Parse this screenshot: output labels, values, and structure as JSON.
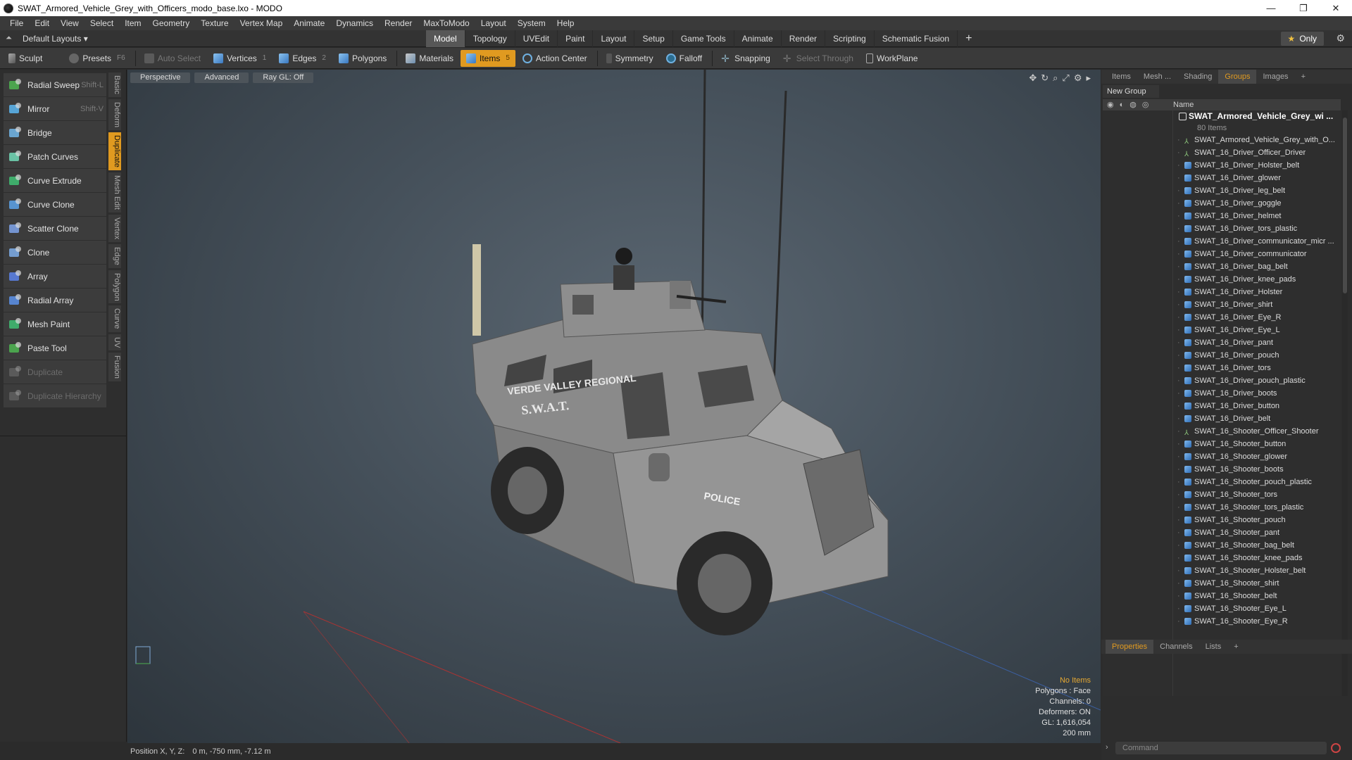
{
  "window": {
    "title": "SWAT_Armored_Vehicle_Grey_with_Officers_modo_base.lxo - MODO",
    "controls": [
      "—",
      "❐",
      "✕"
    ]
  },
  "menu": [
    "File",
    "Edit",
    "View",
    "Select",
    "Item",
    "Geometry",
    "Texture",
    "Vertex Map",
    "Animate",
    "Dynamics",
    "Render",
    "MaxToModo",
    "Layout",
    "System",
    "Help"
  ],
  "layout": {
    "selector": "Default Layouts ▾",
    "tabs": [
      "Model",
      "Topology",
      "UVEdit",
      "Paint",
      "Layout",
      "Setup",
      "Game Tools",
      "Animate",
      "Render",
      "Scripting",
      "Schematic Fusion"
    ],
    "active_tab": "Model",
    "plus": "+",
    "only_star": "★",
    "only_label": "Only",
    "gear": "⚙"
  },
  "toolbar": {
    "sculpt": "Sculpt",
    "presets": "Presets",
    "presets_key": "F6",
    "auto_select": "Auto Select",
    "vertices": "Vertices",
    "vertices_num": "1",
    "edges": "Edges",
    "edges_num": "2",
    "polygons": "Polygons",
    "materials": "Materials",
    "items": "Items",
    "items_num": "5",
    "action_center": "Action Center",
    "symmetry": "Symmetry",
    "falloff": "Falloff",
    "snapping": "Snapping",
    "select_through": "Select Through",
    "workplane": "WorkPlane"
  },
  "tools": [
    {
      "label": "Radial Sweep",
      "shortcut": "Shift-L",
      "disabled": false
    },
    {
      "label": "Mirror",
      "shortcut": "Shift-V",
      "disabled": false
    },
    {
      "label": "Bridge",
      "shortcut": "",
      "disabled": false
    },
    {
      "label": "Patch Curves",
      "shortcut": "",
      "disabled": false
    },
    {
      "label": "Curve Extrude",
      "shortcut": "",
      "disabled": false
    },
    {
      "label": "Curve Clone",
      "shortcut": "",
      "disabled": false
    },
    {
      "label": "Scatter Clone",
      "shortcut": "",
      "disabled": false
    },
    {
      "label": "Clone",
      "shortcut": "",
      "disabled": false
    },
    {
      "label": "Array",
      "shortcut": "",
      "disabled": false
    },
    {
      "label": "Radial Array",
      "shortcut": "",
      "disabled": false
    },
    {
      "label": "Mesh Paint",
      "shortcut": "",
      "disabled": false
    },
    {
      "label": "Paste Tool",
      "shortcut": "",
      "disabled": false
    },
    {
      "label": "Duplicate",
      "shortcut": "",
      "disabled": true
    },
    {
      "label": "Duplicate Hierarchy",
      "shortcut": "",
      "disabled": true
    }
  ],
  "side_tabs": [
    "Basic",
    "Deform",
    "Duplicate",
    "Mesh Edit",
    "Vertex",
    "Edge",
    "Polygon",
    "Curve",
    "UV",
    "Fusion"
  ],
  "active_side_tab": "Duplicate",
  "viewport": {
    "view": "Perspective",
    "shading": "Advanced",
    "raygl": "Ray GL: Off",
    "icons": [
      "✥",
      "↻",
      "⌕",
      "⤢",
      "⚙",
      "▸"
    ],
    "info": {
      "items": "No Items",
      "polygons": "Polygons : Face",
      "channels": "Channels: 0",
      "deformers": "Deformers: ON",
      "gl": "GL: 1,616,054",
      "scale": "200 mm"
    },
    "decals": {
      "line1": "VERDE VALLEY REGIONAL",
      "line2": "S.W.A.T.",
      "police": "POLICE"
    }
  },
  "status": {
    "label": "Position X, Y, Z:",
    "value": "0 m, -750 mm, -7.12 m"
  },
  "right_panel": {
    "tabs": [
      "Items",
      "Mesh ...",
      "Shading",
      "Groups",
      "Images",
      "+"
    ],
    "active_tab": "Groups",
    "new_group": "New Group",
    "name_header": "Name",
    "group_name": "SWAT_Armored_Vehicle_Grey_wi ...",
    "group_count": "80 Items",
    "items": [
      {
        "name": "SWAT_Armored_Vehicle_Grey_with_O...",
        "type": "locator"
      },
      {
        "name": "SWAT_16_Driver_Officer_Driver",
        "type": "locator"
      },
      {
        "name": "SWAT_16_Driver_Holster_belt",
        "type": "mesh"
      },
      {
        "name": "SWAT_16_Driver_glower",
        "type": "mesh"
      },
      {
        "name": "SWAT_16_Driver_leg_belt",
        "type": "mesh"
      },
      {
        "name": "SWAT_16_Driver_goggle",
        "type": "mesh"
      },
      {
        "name": "SWAT_16_Driver_helmet",
        "type": "mesh"
      },
      {
        "name": "SWAT_16_Driver_tors_plastic",
        "type": "mesh"
      },
      {
        "name": "SWAT_16_Driver_communicator_micr ...",
        "type": "mesh"
      },
      {
        "name": "SWAT_16_Driver_communicator",
        "type": "mesh"
      },
      {
        "name": "SWAT_16_Driver_bag_belt",
        "type": "mesh"
      },
      {
        "name": "SWAT_16_Driver_knee_pads",
        "type": "mesh"
      },
      {
        "name": "SWAT_16_Driver_Holster",
        "type": "mesh"
      },
      {
        "name": "SWAT_16_Driver_shirt",
        "type": "mesh"
      },
      {
        "name": "SWAT_16_Driver_Eye_R",
        "type": "mesh"
      },
      {
        "name": "SWAT_16_Driver_Eye_L",
        "type": "mesh"
      },
      {
        "name": "SWAT_16_Driver_pant",
        "type": "mesh"
      },
      {
        "name": "SWAT_16_Driver_pouch",
        "type": "mesh"
      },
      {
        "name": "SWAT_16_Driver_tors",
        "type": "mesh"
      },
      {
        "name": "SWAT_16_Driver_pouch_plastic",
        "type": "mesh"
      },
      {
        "name": "SWAT_16_Driver_boots",
        "type": "mesh"
      },
      {
        "name": "SWAT_16_Driver_button",
        "type": "mesh"
      },
      {
        "name": "SWAT_16_Driver_belt",
        "type": "mesh"
      },
      {
        "name": "SWAT_16_Shooter_Officer_Shooter",
        "type": "locator"
      },
      {
        "name": "SWAT_16_Shooter_button",
        "type": "mesh"
      },
      {
        "name": "SWAT_16_Shooter_glower",
        "type": "mesh"
      },
      {
        "name": "SWAT_16_Shooter_boots",
        "type": "mesh"
      },
      {
        "name": "SWAT_16_Shooter_pouch_plastic",
        "type": "mesh"
      },
      {
        "name": "SWAT_16_Shooter_tors",
        "type": "mesh"
      },
      {
        "name": "SWAT_16_Shooter_tors_plastic",
        "type": "mesh"
      },
      {
        "name": "SWAT_16_Shooter_pouch",
        "type": "mesh"
      },
      {
        "name": "SWAT_16_Shooter_pant",
        "type": "mesh"
      },
      {
        "name": "SWAT_16_Shooter_bag_belt",
        "type": "mesh"
      },
      {
        "name": "SWAT_16_Shooter_knee_pads",
        "type": "mesh"
      },
      {
        "name": "SWAT_16_Shooter_Holster_belt",
        "type": "mesh"
      },
      {
        "name": "SWAT_16_Shooter_shirt",
        "type": "mesh"
      },
      {
        "name": "SWAT_16_Shooter_belt",
        "type": "mesh"
      },
      {
        "name": "SWAT_16_Shooter_Eye_L",
        "type": "mesh"
      },
      {
        "name": "SWAT_16_Shooter_Eye_R",
        "type": "mesh"
      }
    ],
    "bottom_tabs": [
      "Properties",
      "Channels",
      "Lists",
      "+"
    ],
    "active_bottom_tab": "Properties",
    "command_placeholder": "Command"
  },
  "colors": {
    "accent": "#e09a20",
    "panel": "#2e2e2e",
    "viewport_bg": "#45505a"
  }
}
